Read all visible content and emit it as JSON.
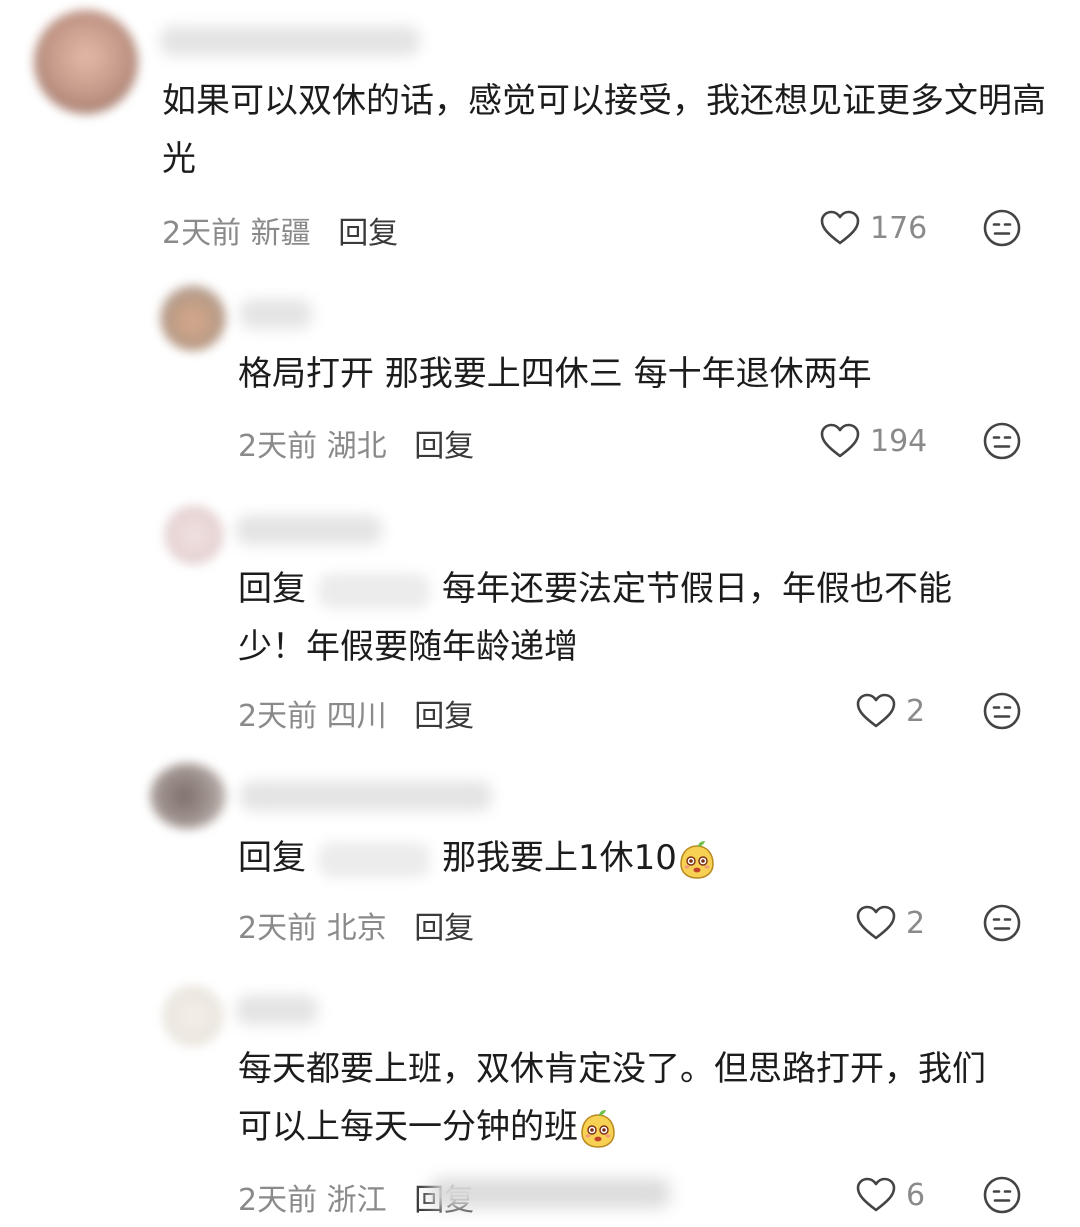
{
  "icons": {
    "like": "heart-outline-icon",
    "react": "neutral-face-icon",
    "sticker": "yellow-mango-sticker-icon"
  },
  "comments": [
    {
      "text": "如果可以双休的话，感觉可以接受，我还想见证更多文明高光",
      "time": "2天前",
      "location": "新疆",
      "reply_label": "回复",
      "likes": "176"
    },
    {
      "text": "格局打开 那我要上四休三 每十年退休两年",
      "time": "2天前",
      "location": "湖北",
      "reply_label": "回复",
      "likes": "194"
    },
    {
      "reply_prefix": "回复",
      "text": "每年还要法定节假日，年假也不能少！年假要随年龄递增",
      "time": "2天前",
      "location": "四川",
      "reply_label": "回复",
      "likes": "2"
    },
    {
      "reply_prefix": "回复",
      "text": "那我要上1休10",
      "time": "2天前",
      "location": "北京",
      "reply_label": "回复",
      "likes": "2"
    },
    {
      "text": "每天都要上班，双休肯定没了。但思路打开，我们可以上每天一分钟的班",
      "time": "2天前",
      "location": "浙江",
      "reply_label": "回复",
      "likes": "6"
    }
  ]
}
